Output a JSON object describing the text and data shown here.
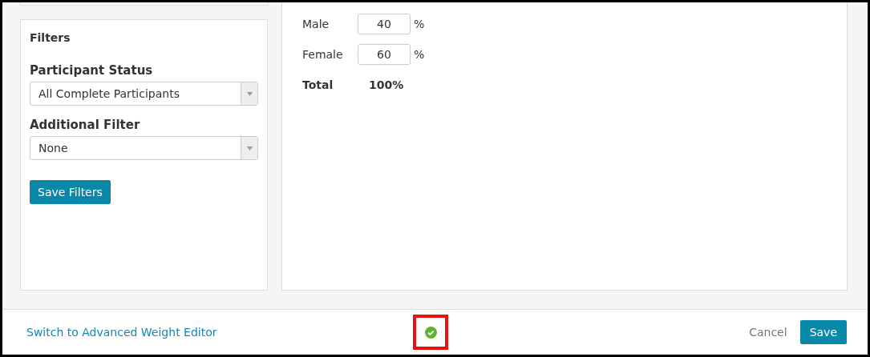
{
  "filters": {
    "title": "Filters",
    "fields": [
      {
        "label": "Participant Status",
        "value": "All Complete Participants"
      },
      {
        "label": "Additional Filter",
        "value": "None"
      }
    ],
    "save_button": "Save Filters"
  },
  "weights": {
    "rows": [
      {
        "label": "Male",
        "value": "40",
        "unit": "%"
      },
      {
        "label": "Female",
        "value": "60",
        "unit": "%"
      }
    ],
    "total": {
      "label": "Total",
      "value": "100%"
    }
  },
  "footer": {
    "link": "Switch to Advanced Weight Editor",
    "status_ok": true,
    "highlighted": true,
    "cancel": "Cancel",
    "save": "Save"
  }
}
